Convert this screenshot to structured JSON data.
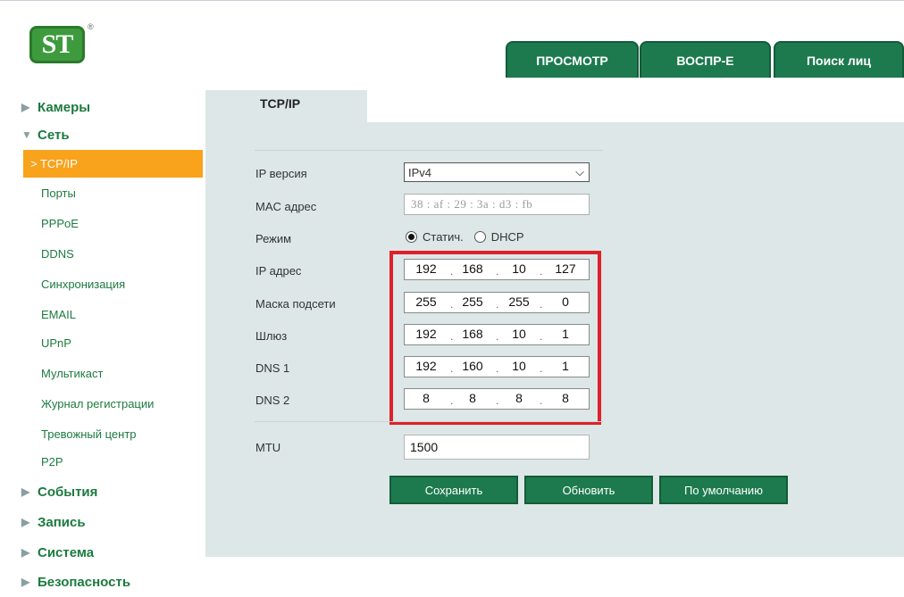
{
  "header": {
    "logo_text": "ST",
    "logo_reg": "®",
    "tabs": [
      {
        "label": "ПРОСМОТР"
      },
      {
        "label": "ВОСПР-Е"
      },
      {
        "label": "Поиск лиц"
      }
    ]
  },
  "sidebar": {
    "groups": {
      "cameras": {
        "label": "Камеры",
        "expanded": false
      },
      "network": {
        "label": "Сеть",
        "expanded": true
      },
      "events": {
        "label": "События",
        "expanded": false
      },
      "record": {
        "label": "Запись",
        "expanded": false
      },
      "system": {
        "label": "Система",
        "expanded": false
      },
      "security": {
        "label": "Безопасность",
        "expanded": false
      }
    },
    "active_item": "> TCP/IP",
    "network_items": [
      "Порты",
      "PPPoE",
      "DDNS",
      "Синхронизация",
      "EMAIL",
      "UPnP",
      "Мультикаст",
      "Журнал регистрации",
      "Тревожный центр",
      "P2P"
    ]
  },
  "panel": {
    "tab_label": "TCP/IP",
    "labels": {
      "ip_version": "IP версия",
      "mac": "MAC адрес",
      "mode": "Режим",
      "ip": "IP адрес",
      "mask": "Маска подсети",
      "gateway": "Шлюз",
      "dns1": "DNS 1",
      "dns2": "DNS 2",
      "mtu": "MTU"
    },
    "ip_version_value": "IPv4",
    "mac_value": "38 : af : 29 : 3a : d3 : fb",
    "mode_options": {
      "static": "Статич.",
      "dhcp": "DHCP"
    },
    "mode_selected": "static",
    "ip": [
      "192",
      "168",
      "10",
      "127"
    ],
    "mask": [
      "255",
      "255",
      "255",
      "0"
    ],
    "gateway": [
      "192",
      "168",
      "10",
      "1"
    ],
    "dns1": [
      "192",
      "160",
      "10",
      "1"
    ],
    "dns2": [
      "8",
      "8",
      "8",
      "8"
    ],
    "mtu_value": "1500",
    "buttons": {
      "save": "Сохранить",
      "refresh": "Обновить",
      "default": "По умолчанию"
    },
    "highlight_color": "#e0202a"
  },
  "colors": {
    "accent_green": "#1d7a4e",
    "active_orange": "#f9a21b",
    "panel_bg": "#dde7e7",
    "link_green": "#1c7a3f"
  }
}
